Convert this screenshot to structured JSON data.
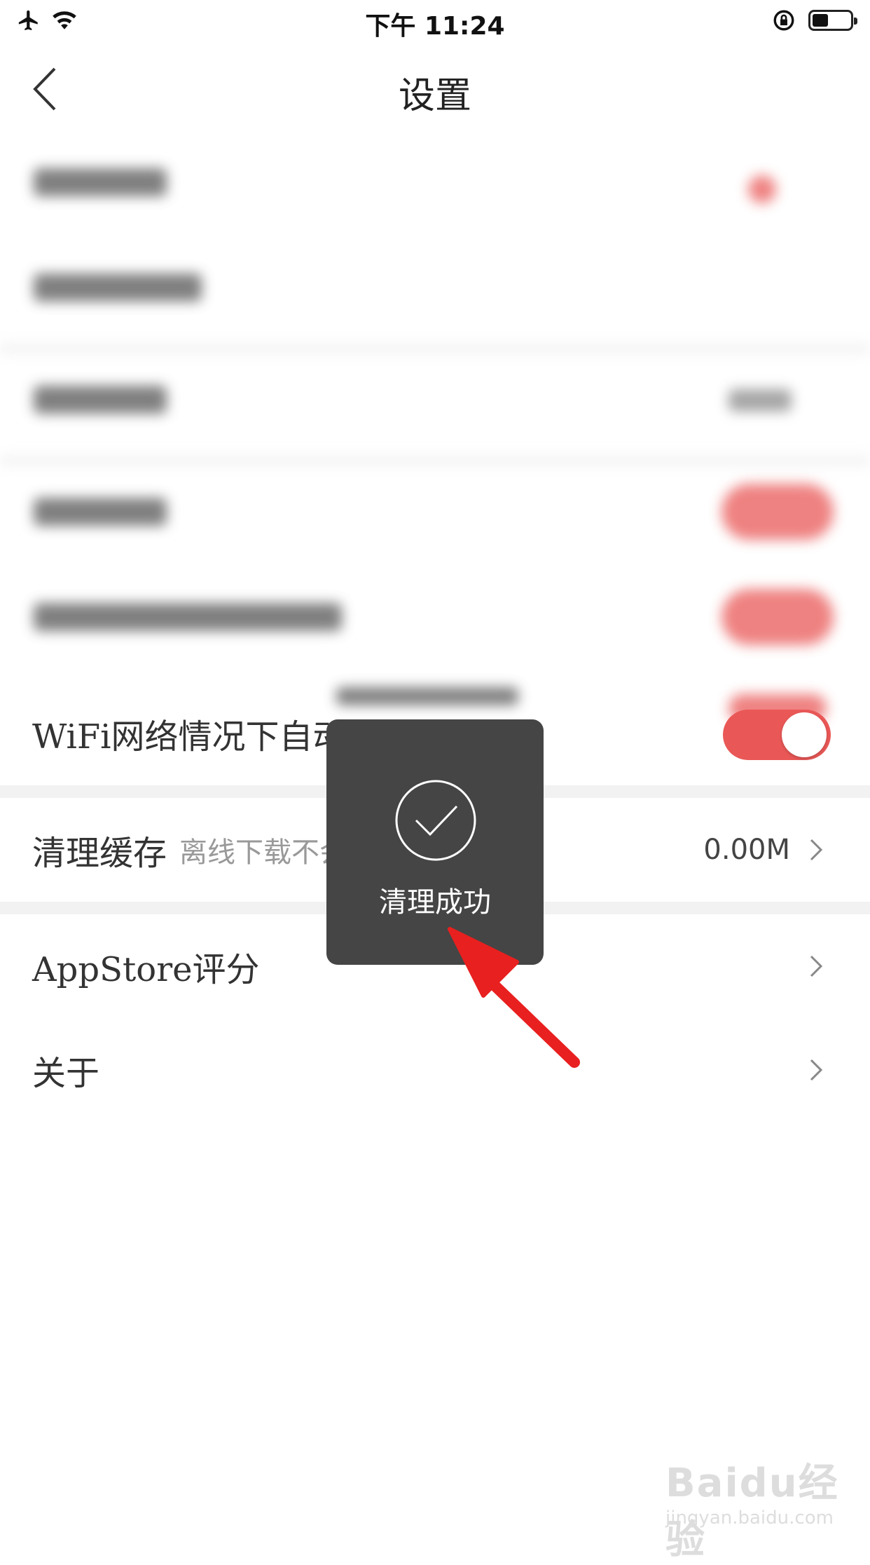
{
  "status_bar": {
    "time": "下午 11:24"
  },
  "header": {
    "title": "设置"
  },
  "settings": {
    "wifi_autoplay": {
      "label": "WiFi网络情况下自动播放视频",
      "enabled": true
    },
    "clear_cache": {
      "label": "清理缓存",
      "hint": "离线下载不会被清理",
      "value": "0.00M"
    },
    "appstore_rating": {
      "label": "AppStore评分"
    },
    "about": {
      "label": "关于"
    }
  },
  "toast": {
    "message": "清理成功"
  },
  "watermark": {
    "brand": "Baidu经验",
    "url": "jingyan.baidu.com"
  },
  "colors": {
    "accent": "#e95857",
    "toast_bg": "#454545",
    "arrow": "#e8201f"
  },
  "icons": [
    "airplane-icon",
    "wifi-icon",
    "rotation-lock-icon",
    "battery-icon",
    "back-chevron-icon",
    "chevron-right-icon",
    "checkmark-circle-icon",
    "red-arrow-annotation"
  ]
}
